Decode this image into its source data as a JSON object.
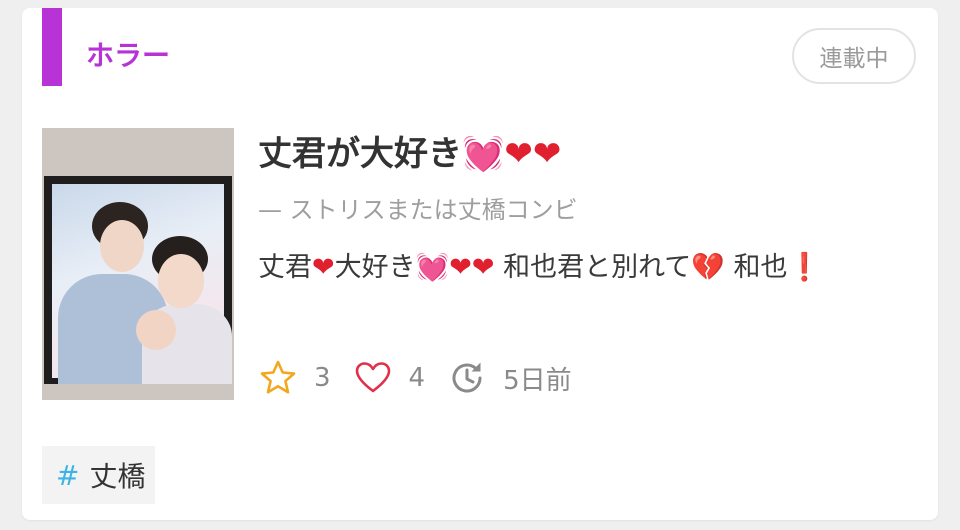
{
  "genre": {
    "label": "ホラー",
    "color": "#b833d6"
  },
  "status": {
    "label": "連載中"
  },
  "story": {
    "title_text": "丈君が大好き",
    "title_hearts": [
      "💓",
      "❤",
      "❤"
    ],
    "subtitle": "— ストリスまたは丈橋コンビ",
    "description": {
      "p1": "丈君",
      "p2": "大好き",
      "p3": "和也君と別れて",
      "p4": "和也"
    },
    "thumbnail_alt": "photo"
  },
  "stats": {
    "stars": "3",
    "likes": "4",
    "updated": "5日前",
    "icons": [
      "star-icon",
      "heart-outline-icon",
      "history-clock-icon"
    ]
  },
  "tags": [
    {
      "hash": "#",
      "label": "丈橋"
    }
  ],
  "colors": {
    "accent": "#b833d6",
    "star": "#f2a81d",
    "heart": "#e0202f",
    "hashtag": "#3fb3e6"
  }
}
